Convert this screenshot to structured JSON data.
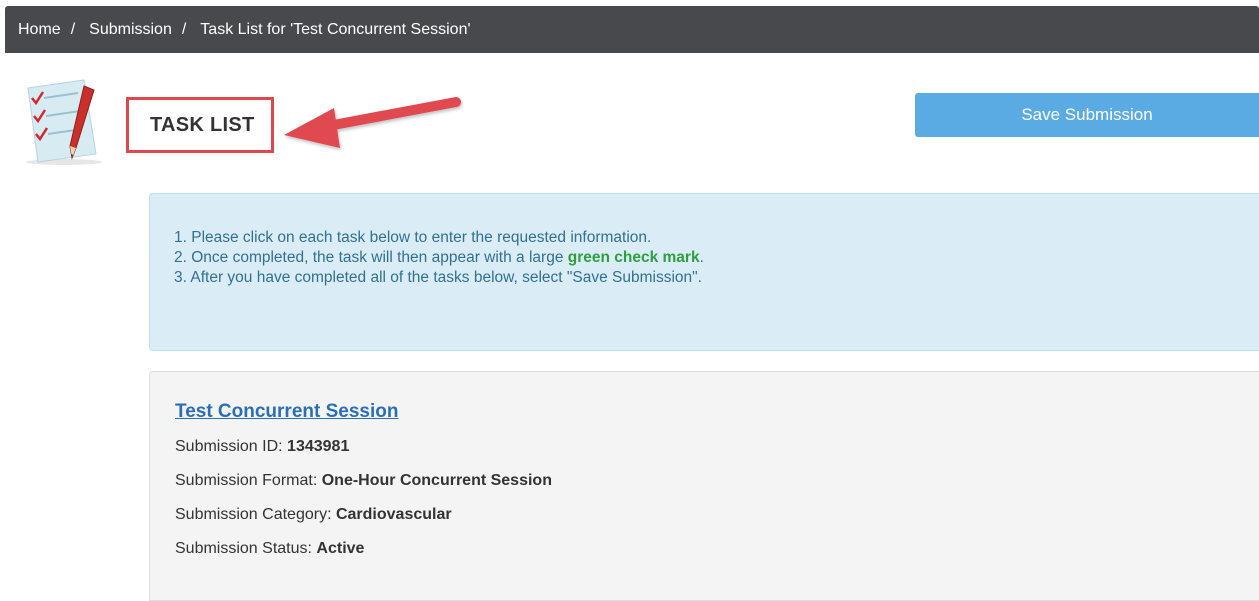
{
  "breadcrumb": {
    "items": [
      {
        "label": "Home"
      },
      {
        "label": "Submission"
      },
      {
        "label": "Task List for 'Test Concurrent Session'"
      }
    ],
    "separator": "/"
  },
  "header": {
    "title": "TASK LIST",
    "icon": "task-list-icon"
  },
  "toolbar": {
    "save_label": "Save Submission"
  },
  "instructions": {
    "line1": "1. Please click on each task below to enter the requested information.",
    "line2_prefix": "2. Once completed, the task will then appear with a large ",
    "line2_highlight": "green check mark",
    "line2_suffix": ".",
    "line3": "3. After you have completed all of the tasks below, select \"Save Submission\"."
  },
  "submission": {
    "title": "Test Concurrent Session",
    "fields": [
      {
        "label": "Submission ID: ",
        "value": "1343981"
      },
      {
        "label": "Submission Format: ",
        "value": "One-Hour Concurrent Session"
      },
      {
        "label": "Submission Category: ",
        "value": "Cardiovascular"
      },
      {
        "label": "Submission Status: ",
        "value": "Active"
      }
    ]
  },
  "colors": {
    "breadcrumb_bg": "#47494c",
    "accent_button": "#5aabe3",
    "annotation_red": "#e0484f",
    "info_bg": "#daedf7",
    "info_text": "#31708f",
    "success_green": "#2e9e3e",
    "link_blue": "#2a6fb6"
  }
}
